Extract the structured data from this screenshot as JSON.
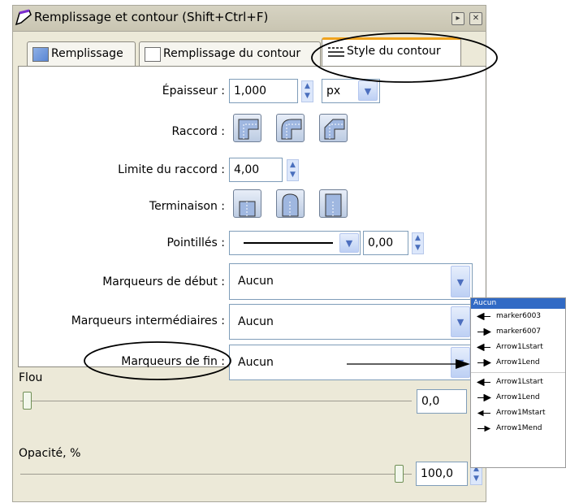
{
  "window": {
    "title": "Remplissage et contour (Shift+Ctrl+F)"
  },
  "tabs": [
    {
      "label": "Remplissage"
    },
    {
      "label": "Remplissage du contour"
    },
    {
      "label": "Style du contour"
    }
  ],
  "stroke_style": {
    "width_label": "Épaisseur :",
    "width_value": "1,000",
    "unit_value": "px",
    "join_label": "Raccord :",
    "miter_label": "Limite du raccord :",
    "miter_value": "4,00",
    "cap_label": "Terminaison :",
    "dash_label": "Pointillés :",
    "dash_offset": "0,00",
    "start_markers_label": "Marqueurs de début :",
    "start_markers_value": "Aucun",
    "mid_markers_label": "Marqueurs intermédiaires :",
    "mid_markers_value": "Aucun",
    "end_markers_label": "Marqueurs de fin :",
    "end_markers_value": "Aucun"
  },
  "blur": {
    "label": "Flou",
    "value": "0,0",
    "fraction": 0.0
  },
  "opacity": {
    "label": "Opacité, %",
    "value": "100,0",
    "fraction": 1.0
  },
  "marker_dropdown": {
    "selected": "Aucun",
    "items": [
      {
        "label": "marker6003",
        "icon": "arrow-left-icon"
      },
      {
        "label": "marker6007",
        "icon": "arrow-right-icon"
      },
      {
        "label": "Arrow1Lstart",
        "icon": "arrow-left-icon"
      },
      {
        "label": "Arrow1Lend",
        "icon": "arrow-right-icon"
      },
      {
        "label": "Arrow1Lstart",
        "icon": "arrow-left-icon"
      },
      {
        "label": "Arrow1Lend",
        "icon": "arrow-right-icon"
      },
      {
        "label": "Arrow1Mstart",
        "icon": "arrow-left-small-icon"
      },
      {
        "label": "Arrow1Mend",
        "icon": "arrow-right-small-icon"
      }
    ]
  },
  "colors": {
    "active_tab_accent": "#f0a31d",
    "selection_blue": "#316ac5",
    "panel_bg": "#ece9d8"
  }
}
